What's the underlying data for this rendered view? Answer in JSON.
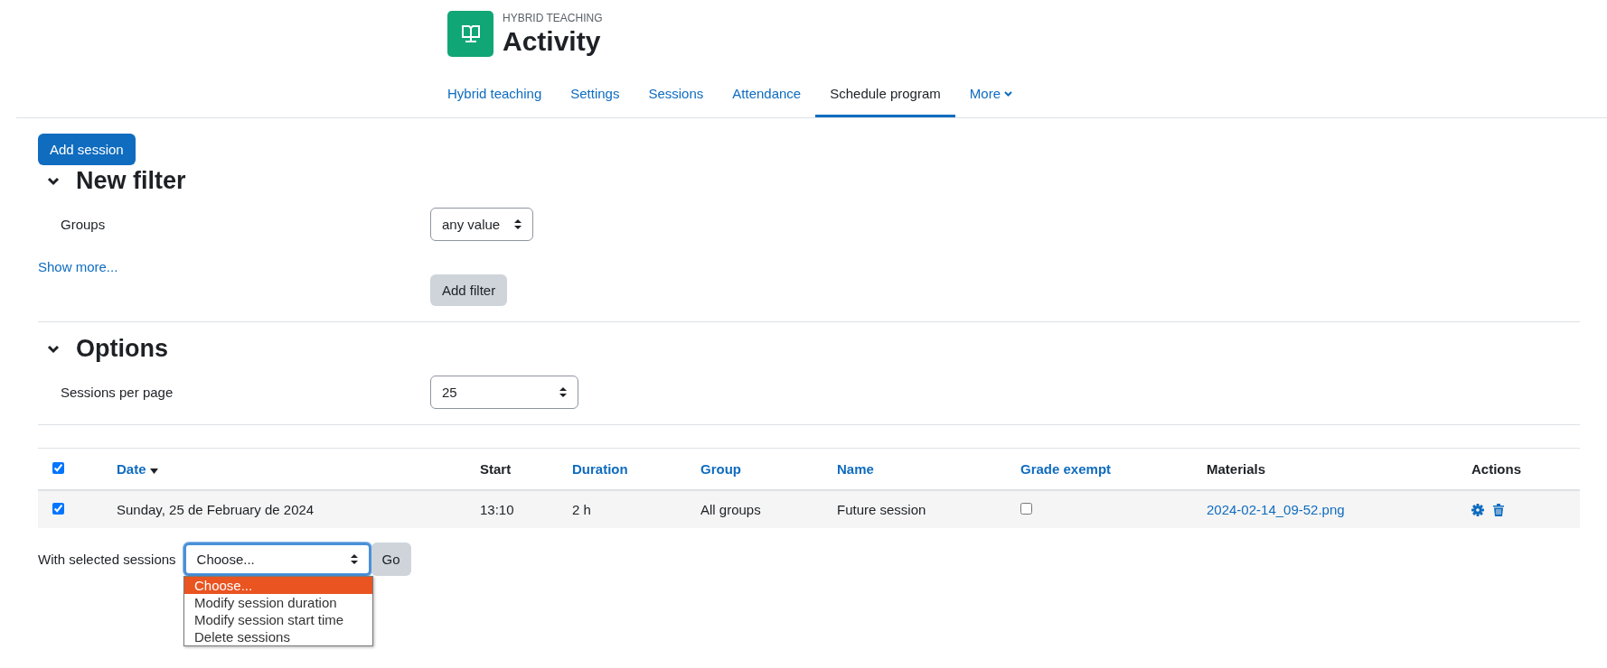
{
  "header": {
    "category": "HYBRID TEACHING",
    "title": "Activity"
  },
  "nav": [
    {
      "label": "Hybrid teaching",
      "selected": false,
      "kind": "link"
    },
    {
      "label": "Settings",
      "selected": false,
      "kind": "link"
    },
    {
      "label": "Sessions",
      "selected": false,
      "kind": "link"
    },
    {
      "label": "Attendance",
      "selected": false,
      "kind": "link"
    },
    {
      "label": "Schedule program",
      "selected": true,
      "kind": "link"
    },
    {
      "label": "More",
      "selected": false,
      "kind": "dropdown"
    }
  ],
  "add_session": "Add session",
  "filter": {
    "heading": "New filter",
    "expanded": true,
    "fields": [
      {
        "label": "Groups",
        "value": "any value"
      }
    ],
    "show_more": "Show more...",
    "add_filter": "Add filter"
  },
  "options": {
    "heading": "Options",
    "expanded": true,
    "fields": [
      {
        "label": "Sessions per page",
        "value": "25"
      }
    ]
  },
  "table": {
    "select_all": {
      "checked": true
    },
    "columns": [
      {
        "label": "Date",
        "link": true,
        "sorted": true
      },
      {
        "label": "Start",
        "link": false,
        "sorted": false
      },
      {
        "label": "Duration",
        "link": true,
        "sorted": false
      },
      {
        "label": "Group",
        "link": true,
        "sorted": false
      },
      {
        "label": "Name",
        "link": true,
        "sorted": false
      },
      {
        "label": "Grade exempt",
        "link": true,
        "sorted": false
      },
      {
        "label": "Materials",
        "link": false,
        "sorted": false
      },
      {
        "label": "Actions",
        "link": false,
        "sorted": false
      }
    ],
    "rows": [
      {
        "selected": true,
        "date": "Sunday, 25 de February de 2024",
        "start": "13:10",
        "duration": "2 h",
        "group": "All groups",
        "name": "Future session",
        "grade_exempt": false,
        "materials": "2024-02-14_09-52.png"
      }
    ]
  },
  "bulk": {
    "label": "With selected sessions",
    "value": "Choose...",
    "go": "Go",
    "expanded": true,
    "options": [
      {
        "label": "Choose...",
        "selected": true
      },
      {
        "label": "Modify session duration",
        "selected": false
      },
      {
        "label": "Modify session start time",
        "selected": false
      },
      {
        "label": "Delete sessions",
        "selected": false
      }
    ]
  }
}
